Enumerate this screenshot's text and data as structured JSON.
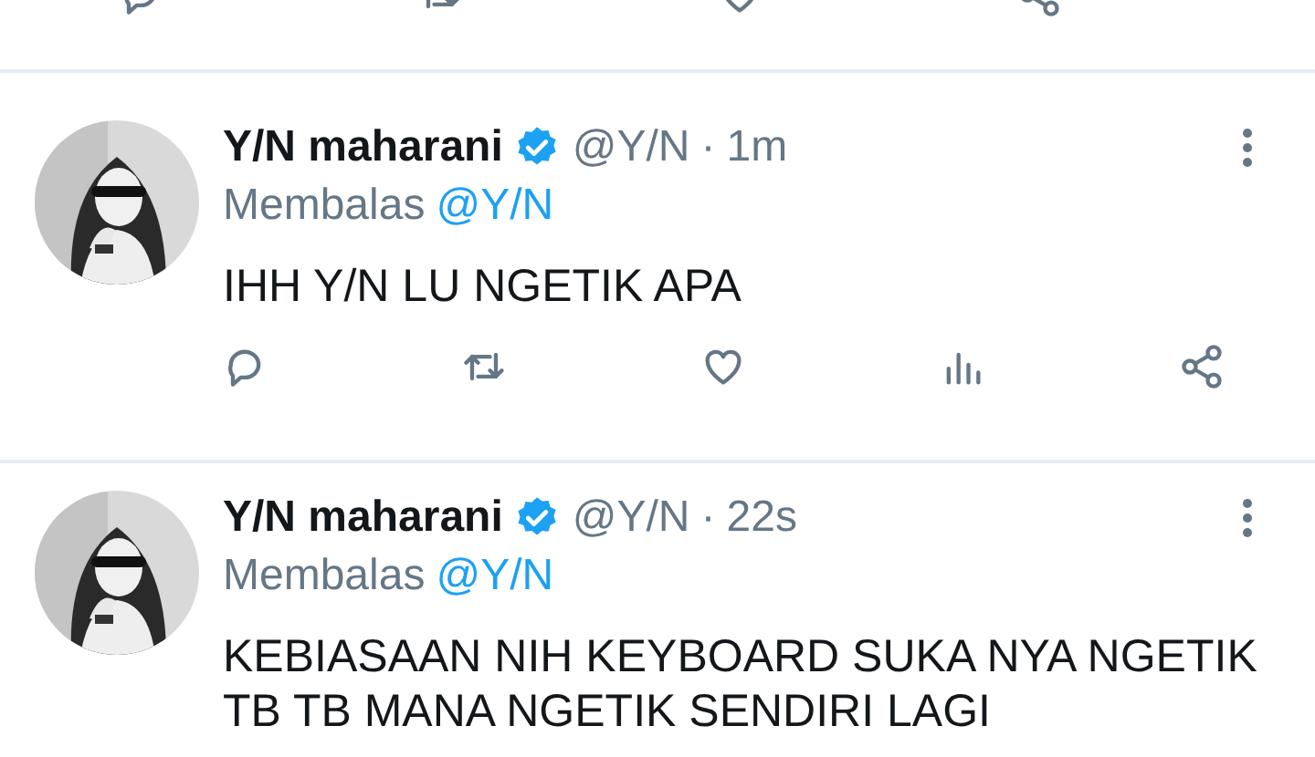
{
  "tweets": [
    {
      "name": "Y/N maharani",
      "verified": true,
      "handle": "@Y/N",
      "separator": "·",
      "time": "1m",
      "reply_label": "Membalas",
      "reply_to": "@Y/N",
      "text": "IHH Y/N LU NGETIK APA"
    },
    {
      "name": "Y/N maharani",
      "verified": true,
      "handle": "@Y/N",
      "separator": "·",
      "time": "22s",
      "reply_label": "Membalas",
      "reply_to": "@Y/N",
      "text": "KEBIASAAN NIH KEYBOARD SUKA NYA NGETIK TB TB MANA NGETIK SENDIRI LAGI"
    }
  ]
}
